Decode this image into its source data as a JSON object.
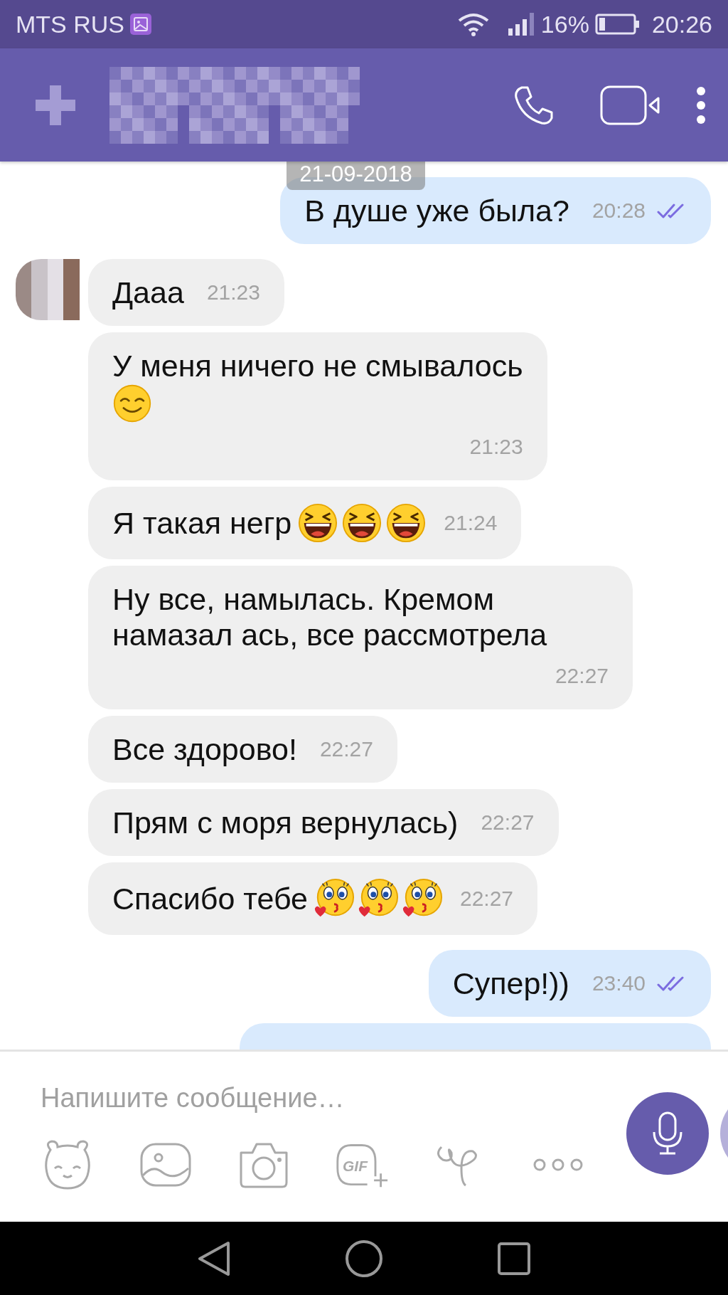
{
  "status_bar": {
    "carrier": "MTS RUS",
    "battery": "16%",
    "time": "20:26"
  },
  "date_badge": "21-09-2018",
  "messages": [
    {
      "kind": "outgoing",
      "time_below": false,
      "text": "В душе уже была?",
      "time": "20:28",
      "seen": true
    },
    {
      "kind": "incoming",
      "time_below": false,
      "avatar": true,
      "text": "Дааа",
      "time": "21:23"
    },
    {
      "kind": "incoming",
      "time_below": true,
      "avatar": false,
      "text": "У меня ничего не смывалось",
      "emojis": [
        {
          "kind": "smiling"
        }
      ],
      "time": "21:23"
    },
    {
      "kind": "incoming",
      "time_below": false,
      "avatar": false,
      "text": "Я такая негр",
      "emojis": [
        {
          "kind": "laughing"
        },
        {
          "kind": "laughing"
        },
        {
          "kind": "laughing"
        }
      ],
      "time": "21:24"
    },
    {
      "kind": "incoming",
      "time_below": true,
      "avatar": false,
      "text": "Ну все, намылась. Кремом намазал ась, все рассмотрела",
      "time": "22:27"
    },
    {
      "kind": "incoming",
      "time_below": false,
      "avatar": false,
      "text": "Все здорово!",
      "time": "22:27"
    },
    {
      "kind": "incoming",
      "time_below": false,
      "avatar": false,
      "text": "Прям с моря вернулась)",
      "time": "22:27"
    },
    {
      "kind": "incoming",
      "time_below": false,
      "avatar": false,
      "text": "Спасибо тебе",
      "emojis": [
        {
          "kind": "kissing"
        },
        {
          "kind": "kissing"
        },
        {
          "kind": "kissing"
        }
      ],
      "time": "22:27"
    },
    {
      "kind": "outgoing",
      "time_below": false,
      "text": "Супер!))",
      "time": "23:40",
      "seen": true
    },
    {
      "kind": "outgoing"
    }
  ],
  "composer": {
    "placeholder": "Напишите сообщение…",
    "gif_label": "GIF"
  }
}
